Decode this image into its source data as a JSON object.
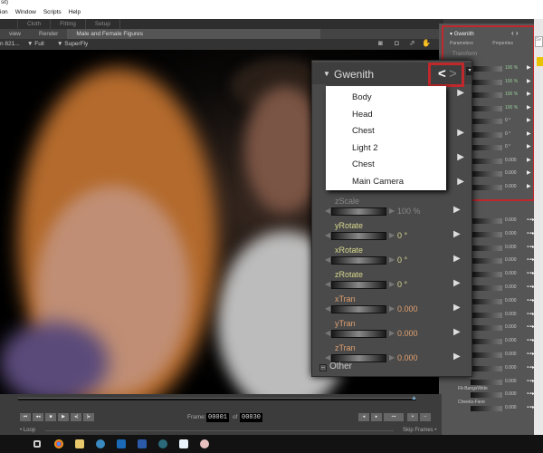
{
  "window": {
    "title": "sit)"
  },
  "menu": [
    "ion",
    "Window",
    "Scripts",
    "Help"
  ],
  "room_tabs": [
    "Cloth",
    "Fitting",
    "Setup"
  ],
  "toolbar_row2": {
    "view": "view",
    "render": "Render",
    "figure_menu": "Male and Female Figures"
  },
  "toolbar_row3": {
    "camera": "n 821...",
    "quality": "▼ Full",
    "renderer": "▼ SuperFly"
  },
  "parameters_popup": {
    "title": "Gwenith",
    "dropdown_items": [
      "Body",
      "Head",
      "Chest",
      "Light 2",
      "Chest",
      "Main Camera"
    ],
    "params": [
      {
        "label": "zScale",
        "value": "100 %",
        "color": "#888888"
      },
      {
        "label": "yRotate",
        "value": "0 °",
        "color": "#d8d890"
      },
      {
        "label": "xRotate",
        "value": "0 °",
        "color": "#d8d890"
      },
      {
        "label": "zRotate",
        "value": "0 °",
        "color": "#d8d890"
      },
      {
        "label": "xTran",
        "value": "0.000",
        "color": "#e0a070"
      },
      {
        "label": "yTran",
        "value": "0.000",
        "color": "#e0a070"
      },
      {
        "label": "zTran",
        "value": "0.000",
        "color": "#e0a070"
      }
    ],
    "other_group": "Other"
  },
  "right_panel": {
    "title": "Gwenith",
    "tabs": [
      "Parameters",
      "Properties"
    ],
    "group": "Transform",
    "values": [
      "100 %",
      "100 %",
      "100 %",
      "100 %",
      "0 °",
      "0 °",
      "0 °",
      "0.000",
      "0.000",
      "0.000"
    ],
    "morph_values": [
      "0.000",
      "0.000",
      "0.000",
      "0.000",
      "0.000",
      "0.000",
      "0.000",
      "0.000",
      "0.000",
      "0.000",
      "0.000",
      "0.000",
      "0.000",
      "0.000",
      "0.000"
    ],
    "morph_labels": [
      "Fit-BangsWide",
      "Cheeks-Fiere"
    ],
    "search_placeholder": "Se"
  },
  "timeline": {
    "frame_label": "Frame:",
    "current_frame": "00001",
    "of_label": "of",
    "total_frames": "00030",
    "loop_label": "Loop",
    "skip_frames_label": "Skip Frames"
  },
  "colors": {
    "highlight": "#c0282c",
    "panel": "#4a4a4a"
  }
}
